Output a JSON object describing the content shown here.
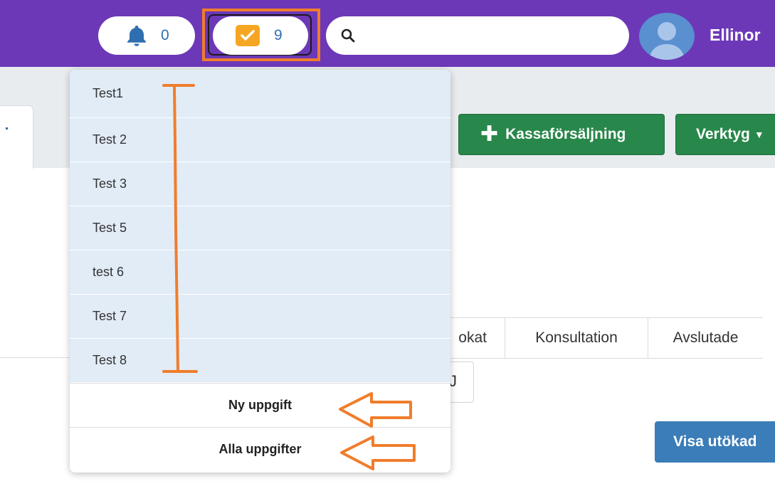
{
  "header": {
    "notifications_count": "0",
    "tasks_count": "9",
    "search_placeholder": "",
    "username": "Ellinor"
  },
  "toolbar": {
    "kassa_label": "Kassaförsäljning",
    "verktyg_label": "Verktyg"
  },
  "tabs": [
    {
      "label": "okat"
    },
    {
      "label": "Konsultation"
    },
    {
      "label": "Avslutade"
    }
  ],
  "small_box_text": "J",
  "visa_label": "Visa utökad",
  "dropdown": {
    "tasks": [
      {
        "label": "Test1"
      },
      {
        "label": "Test 2"
      },
      {
        "label": "Test 3"
      },
      {
        "label": "Test 5"
      },
      {
        "label": "test 6"
      },
      {
        "label": "Test 7"
      },
      {
        "label": "Test 8"
      }
    ],
    "new_task_label": "Ny uppgift",
    "all_tasks_label": "Alla uppgifter"
  },
  "colors": {
    "topbar": "#6c38b8",
    "accent_orange": "#f07d2c",
    "green_button": "#28874a",
    "blue_button": "#3a7db8",
    "task_item_bg": "#e1ecf7"
  }
}
